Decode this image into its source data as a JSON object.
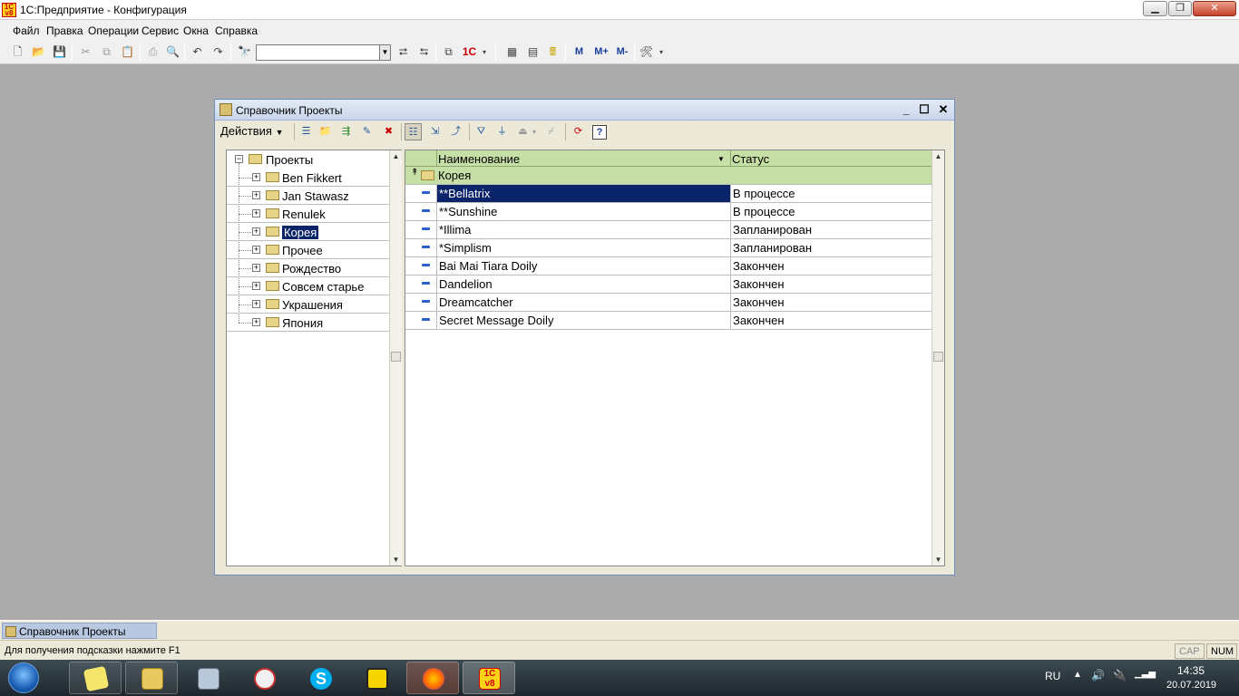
{
  "app": {
    "title": "1С:Предприятие - Конфигурация",
    "logo_text": "1C v8"
  },
  "menu": [
    "Файл",
    "Правка",
    "Операции",
    "Сервис",
    "Окна",
    "Справка"
  ],
  "toolbar": {
    "m_label": "M",
    "mplus_label": "M+",
    "mminus_label": "M-",
    "search_value": ""
  },
  "dialog": {
    "title": "Справочник Проекты",
    "actions_label": "Действия",
    "tree": {
      "root": "Проекты",
      "items": [
        "Ben Fikkert",
        "Jan Stawasz",
        "Renulek",
        "Корея",
        "Прочее",
        "Рождество",
        "Совсем старье",
        "Украшения",
        "Япония"
      ],
      "selected": "Корея"
    },
    "grid": {
      "columns": [
        "Наименование",
        "Статус"
      ],
      "group_row": "Корея",
      "rows": [
        {
          "name": "**Bellatrix",
          "status": "В процессе"
        },
        {
          "name": "**Sunshine",
          "status": "В процессе"
        },
        {
          "name": "*Illima",
          "status": "Запланирован"
        },
        {
          "name": "*Simplism",
          "status": "Запланирован"
        },
        {
          "name": "Bai Mai Tiara Doily",
          "status": "Закончен"
        },
        {
          "name": "Dandelion",
          "status": "Закончен"
        },
        {
          "name": "Dreamcatcher",
          "status": "Закончен"
        },
        {
          "name": "Secret Message Doily",
          "status": "Закончен"
        }
      ]
    }
  },
  "window_tab": "Справочник Проекты",
  "status": {
    "hint": "Для получения подсказки нажмите F1",
    "cap": "CAP",
    "num": "NUM"
  },
  "tray": {
    "lang": "RU",
    "time": "14:35",
    "date": "20.07.2019"
  },
  "colors": {
    "grid_header": "#c5dfa6",
    "selection": "#0a246a",
    "taskbar": "#2a353c"
  }
}
